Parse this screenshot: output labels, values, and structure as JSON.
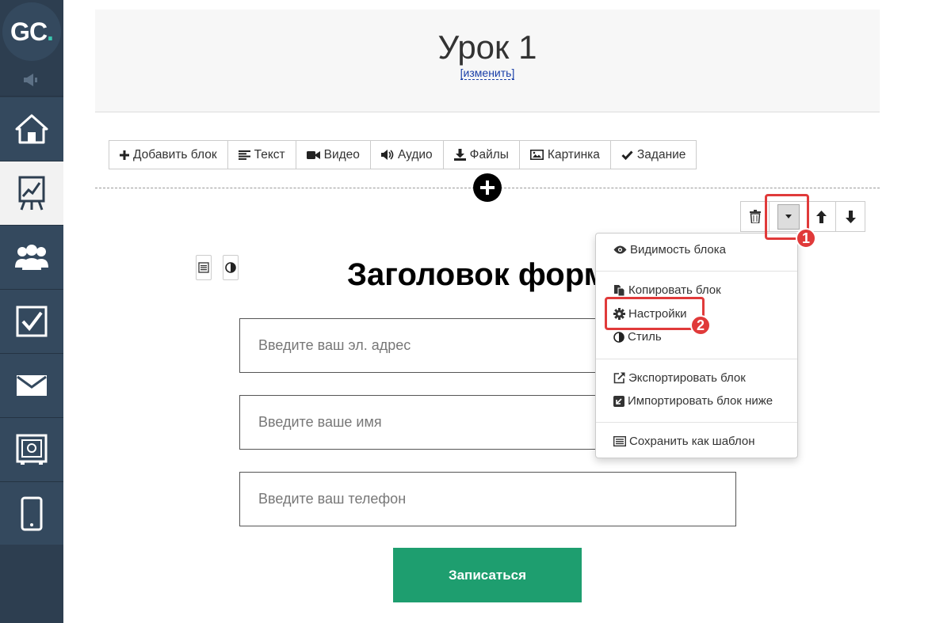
{
  "sidebar": {
    "logo_text": "GC",
    "logo_dot": ".",
    "nav_items": [
      {
        "icon": "home-icon"
      },
      {
        "icon": "presentation-chart-icon"
      },
      {
        "icon": "users-icon"
      },
      {
        "icon": "checkbox-icon"
      },
      {
        "icon": "mail-icon"
      },
      {
        "icon": "safe-icon"
      },
      {
        "icon": "mobile-icon"
      }
    ]
  },
  "header": {
    "title": "Урок 1",
    "edit_link": "[изменить]"
  },
  "toolbar": {
    "add_block": "Добавить блок",
    "text": "Текст",
    "video": "Видео",
    "audio": "Аудио",
    "files": "Файлы",
    "image": "Картинка",
    "task": "Задание"
  },
  "form": {
    "title": "Заголовок формы",
    "email_placeholder": "Введите ваш эл. адрес",
    "name_placeholder": "Введите ваше имя",
    "phone_placeholder": "Введите ваш телефон",
    "submit_label": "Записаться"
  },
  "menu": {
    "visibility": "Видимость блока",
    "copy": "Копировать блок",
    "settings": "Настройки",
    "style": "Стиль",
    "export": "Экспортировать блок",
    "import": "Импортировать блок ниже",
    "save_template": "Сохранить как шаблон"
  },
  "annotations": {
    "badge1": "1",
    "badge2": "2",
    "highlight_color": "#e03a3a"
  },
  "colors": {
    "sidebar": "#2d3e50",
    "submit_button": "#1e9e6f",
    "logo_accent": "#3ac8b0"
  }
}
